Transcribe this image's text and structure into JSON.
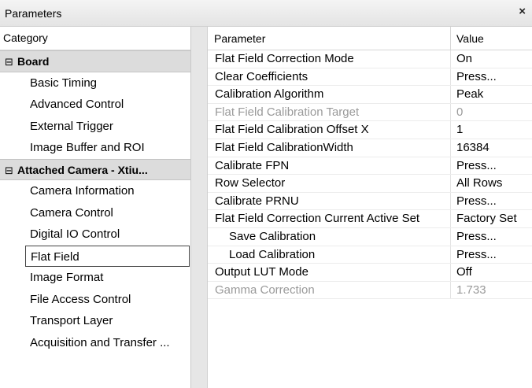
{
  "window": {
    "title": "Parameters",
    "close_glyph": "×"
  },
  "categories": {
    "header": "Category",
    "groups": [
      {
        "toggle": "⊟",
        "label": "Board",
        "items": [
          "Basic Timing",
          "Advanced Control",
          "External Trigger",
          "Image Buffer and ROI"
        ]
      },
      {
        "toggle": "⊟",
        "label": "Attached Camera - Xtiu...",
        "items": [
          "Camera Information",
          "Camera Control",
          "Digital IO Control",
          "Flat Field",
          "Image Format",
          "File Access Control",
          "Transport Layer",
          "Acquisition and Transfer ..."
        ]
      }
    ],
    "selected": "Flat Field"
  },
  "grid": {
    "header_param": "Parameter",
    "header_value": "Value",
    "rows": [
      {
        "name": "Flat Field Correction Mode",
        "value": "On"
      },
      {
        "name": "Clear Coefficients",
        "value": "Press..."
      },
      {
        "name": "Calibration Algorithm",
        "value": "Peak"
      },
      {
        "name": "Flat Field Calibration Target",
        "value": "0",
        "disabled": true
      },
      {
        "name": "Flat Field Calibration Offset X",
        "value": "1"
      },
      {
        "name": "Flat Field CalibrationWidth",
        "value": "16384"
      },
      {
        "name": "Calibrate FPN",
        "value": "Press..."
      },
      {
        "name": "Row Selector",
        "value": "All Rows"
      },
      {
        "name": "Calibrate PRNU",
        "value": "Press..."
      },
      {
        "name": "Flat Field Correction Current Active Set",
        "value": "Factory Set"
      },
      {
        "name": "Save Calibration",
        "value": "Press...",
        "indent": true
      },
      {
        "name": "Load Calibration",
        "value": "Press...",
        "indent": true
      },
      {
        "name": "Output LUT Mode",
        "value": "Off"
      },
      {
        "name": "Gamma Correction",
        "value": "1.733",
        "disabled": true
      }
    ]
  }
}
